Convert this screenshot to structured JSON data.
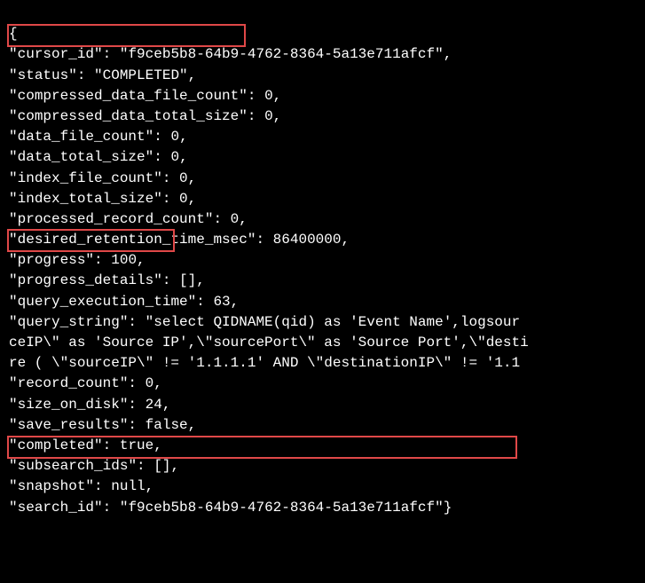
{
  "payload": {
    "cursor_id": "f9ceb5b8-64b9-4762-8364-5a13e711afcf",
    "status": "COMPLETED",
    "compressed_data_file_count": 0,
    "compressed_data_total_size": 0,
    "data_file_count": 0,
    "data_total_size": 0,
    "index_file_count": 0,
    "index_total_size": 0,
    "processed_record_count": 0,
    "desired_retention_time_msec": 86400000,
    "progress": 100,
    "progress_details": "[]",
    "query_execution_time": 63,
    "query_string_line1": "select QIDNAME(qid) as 'Event Name',logsour",
    "query_string_line2": "ceIP\\\" as 'Source IP',\\\"sourcePort\\\" as 'Source Port',\\\"desti",
    "query_string_line3": "re ( \\\"sourceIP\\\" != '1.1.1.1' AND \\\"destinationIP\\\" != '1.1",
    "record_count": 0,
    "size_on_disk": 24,
    "save_results": "false",
    "completed": "true",
    "subsearch_ids": "[]",
    "snapshot": "null",
    "search_id": "f9ceb5b8-64b9-4762-8364-5a13e711afcf"
  },
  "labels": {
    "cursor_id": "cursor_id",
    "status": "status",
    "compressed_data_file_count": "compressed_data_file_count",
    "compressed_data_total_size": "compressed_data_total_size",
    "data_file_count": "data_file_count",
    "data_total_size": "data_total_size",
    "index_file_count": "index_file_count",
    "index_total_size": "index_total_size",
    "processed_record_count": "processed_record_count",
    "desired_retention_time_msec": "desired_retention_time_msec",
    "progress": "progress",
    "progress_details": "progress_details",
    "query_execution_time": "query_execution_time",
    "query_string": "query_string",
    "record_count": "record_count",
    "size_on_disk": "size_on_disk",
    "save_results": "save_results",
    "completed": "completed",
    "subsearch_ids": "subsearch_ids",
    "snapshot": "snapshot",
    "search_id": "search_id"
  }
}
